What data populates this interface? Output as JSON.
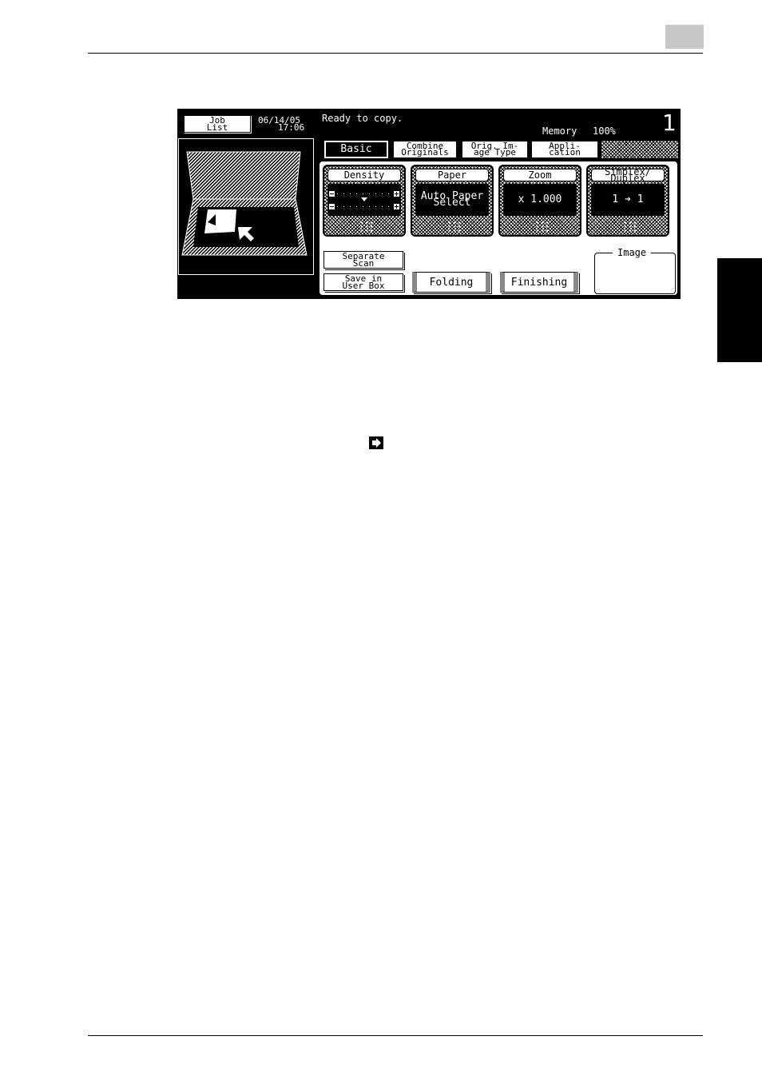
{
  "panel": {
    "job_list": "Job\nList",
    "date": "06/14/05",
    "time": "17:06",
    "status": "Ready to copy.",
    "memory_label": "Memory",
    "memory_value": "100%",
    "copies": "1"
  },
  "tabs": [
    {
      "label": "Basic"
    },
    {
      "label": "Combine\nOriginals"
    },
    {
      "label": "Orig. Im-\nage Type"
    },
    {
      "label": "Appli-\ncation"
    }
  ],
  "cards": {
    "density": {
      "title": "Density"
    },
    "paper": {
      "title": "Paper",
      "value": "Auto Paper\nSelect"
    },
    "zoom": {
      "title": "Zoom",
      "value": "x 1.000"
    },
    "duplex": {
      "title": "Simplex/\nDuplex",
      "value": "1 ➔ 1"
    }
  },
  "buttons": {
    "separate_scan": "Separate\nScan",
    "save_in_user_box": "Save in\nUser Box",
    "folding": "Folding",
    "finishing": "Finishing"
  },
  "image_box": {
    "label": "Image"
  }
}
